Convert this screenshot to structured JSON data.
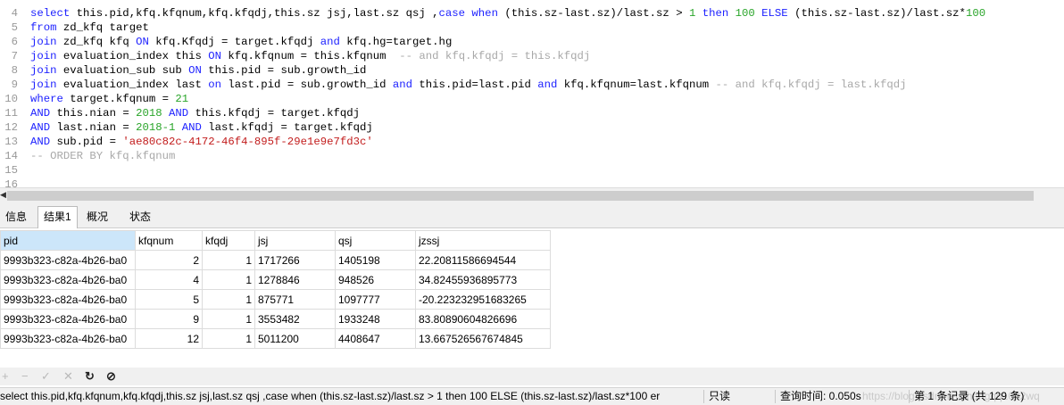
{
  "editor": {
    "lines": [
      {
        "num": "4",
        "segs": [
          {
            "t": "select ",
            "c": "kw"
          },
          {
            "t": "this.pid,kfq.kfqnum,kfq.kfqdj,this.sz jsj,last.sz qsj ,",
            "c": "id"
          },
          {
            "t": "case when ",
            "c": "kw"
          },
          {
            "t": "(this.sz-last.sz)/last.sz > ",
            "c": "id"
          },
          {
            "t": "1 ",
            "c": "num"
          },
          {
            "t": "then ",
            "c": "kw"
          },
          {
            "t": "100 ",
            "c": "num"
          },
          {
            "t": "ELSE ",
            "c": "kw"
          },
          {
            "t": "(this.sz-last.sz)/last.sz*",
            "c": "id"
          },
          {
            "t": "100",
            "c": "num"
          }
        ]
      },
      {
        "num": "5",
        "segs": [
          {
            "t": "from ",
            "c": "kw"
          },
          {
            "t": "zd_kfq target",
            "c": "id"
          }
        ]
      },
      {
        "num": "6",
        "segs": [
          {
            "t": "join ",
            "c": "kw"
          },
          {
            "t": "zd_kfq kfq ",
            "c": "id"
          },
          {
            "t": "ON ",
            "c": "kw"
          },
          {
            "t": "kfq.Kfqdj = target.kfqdj ",
            "c": "id"
          },
          {
            "t": "and ",
            "c": "kw"
          },
          {
            "t": "kfq.hg=target.hg",
            "c": "id"
          }
        ]
      },
      {
        "num": "7",
        "segs": [
          {
            "t": "join ",
            "c": "kw"
          },
          {
            "t": "evaluation_index this ",
            "c": "id"
          },
          {
            "t": "ON ",
            "c": "kw"
          },
          {
            "t": "kfq.kfqnum = this.kfqnum  ",
            "c": "id"
          },
          {
            "t": "-- and kfq.kfqdj = this.kfqdj",
            "c": "cm"
          }
        ]
      },
      {
        "num": "8",
        "segs": [
          {
            "t": "join ",
            "c": "kw"
          },
          {
            "t": "evaluation_sub sub ",
            "c": "id"
          },
          {
            "t": "ON ",
            "c": "kw"
          },
          {
            "t": "this.pid = sub.growth_id",
            "c": "id"
          }
        ]
      },
      {
        "num": "9",
        "segs": [
          {
            "t": "join ",
            "c": "kw"
          },
          {
            "t": "evaluation_index last ",
            "c": "id"
          },
          {
            "t": "on ",
            "c": "kw"
          },
          {
            "t": "last.pid = sub.growth_id ",
            "c": "id"
          },
          {
            "t": "and ",
            "c": "kw"
          },
          {
            "t": "this.pid=last.pid ",
            "c": "id"
          },
          {
            "t": "and ",
            "c": "kw"
          },
          {
            "t": "kfq.kfqnum=last.kfqnum ",
            "c": "id"
          },
          {
            "t": "-- and kfq.kfqdj = last.kfqdj",
            "c": "cm"
          }
        ]
      },
      {
        "num": "10",
        "segs": [
          {
            "t": "where ",
            "c": "kw"
          },
          {
            "t": "target.kfqnum = ",
            "c": "id"
          },
          {
            "t": "21",
            "c": "num"
          }
        ]
      },
      {
        "num": "11",
        "segs": [
          {
            "t": "AND ",
            "c": "kw"
          },
          {
            "t": "this.nian = ",
            "c": "id"
          },
          {
            "t": "2018 ",
            "c": "num"
          },
          {
            "t": "AND ",
            "c": "kw"
          },
          {
            "t": "this.kfqdj = target.kfqdj",
            "c": "id"
          }
        ]
      },
      {
        "num": "12",
        "segs": [
          {
            "t": "AND ",
            "c": "kw"
          },
          {
            "t": "last.nian = ",
            "c": "id"
          },
          {
            "t": "2018-1 ",
            "c": "num"
          },
          {
            "t": "AND ",
            "c": "kw"
          },
          {
            "t": "last.kfqdj = target.kfqdj",
            "c": "id"
          }
        ]
      },
      {
        "num": "13",
        "segs": [
          {
            "t": "AND ",
            "c": "kw"
          },
          {
            "t": "sub.pid = ",
            "c": "id"
          },
          {
            "t": "'ae80c82c-4172-46f4-895f-29e1e9e7fd3c'",
            "c": "str"
          }
        ]
      },
      {
        "num": "14",
        "segs": [
          {
            "t": "-- ORDER BY kfq.kfqnum",
            "c": "cm"
          }
        ]
      },
      {
        "num": "15",
        "segs": []
      },
      {
        "num": "16",
        "segs": []
      }
    ]
  },
  "tabs": [
    "信息",
    "结果1",
    "概况",
    "状态"
  ],
  "active_tab": "结果1",
  "result": {
    "columns": [
      "pid",
      "kfqnum",
      "kfqdj",
      "jsj",
      "qsj",
      "jzssj"
    ],
    "rows": [
      [
        "9993b323-c82a-4b26-ba0",
        "2",
        "1",
        "1717266",
        "1405198",
        "22.20811586694544"
      ],
      [
        "9993b323-c82a-4b26-ba0",
        "4",
        "1",
        "1278846",
        "948526",
        "34.82455936895773"
      ],
      [
        "9993b323-c82a-4b26-ba0",
        "5",
        "1",
        "875771",
        "1097777",
        "-20.223232951683265"
      ],
      [
        "9993b323-c82a-4b26-ba0",
        "9",
        "1",
        "3553482",
        "1933248",
        "83.80890604826696"
      ],
      [
        "9993b323-c82a-4b26-ba0",
        "12",
        "1",
        "5011200",
        "4408647",
        "13.667526567674845"
      ]
    ]
  },
  "toolbar": {
    "icons": [
      "plus-icon",
      "minus-icon",
      "check-icon",
      "cross-icon",
      "refresh-icon",
      "stop-icon"
    ]
  },
  "status": {
    "sql": "select this.pid,kfq.kfqnum,kfq.kfqdj,this.sz jsj,last.sz qsj ,case when (this.sz-last.sz)/last.sz > 1 then 100 ELSE (this.sz-last.sz)/last.sz*100 er",
    "mode": "只读",
    "query_time": "查询时间: 0.050s",
    "records": "第 1 条记录 (共 129 条)",
    "watermark": "https://blog.csdn.net/zhangqq1002wq"
  }
}
